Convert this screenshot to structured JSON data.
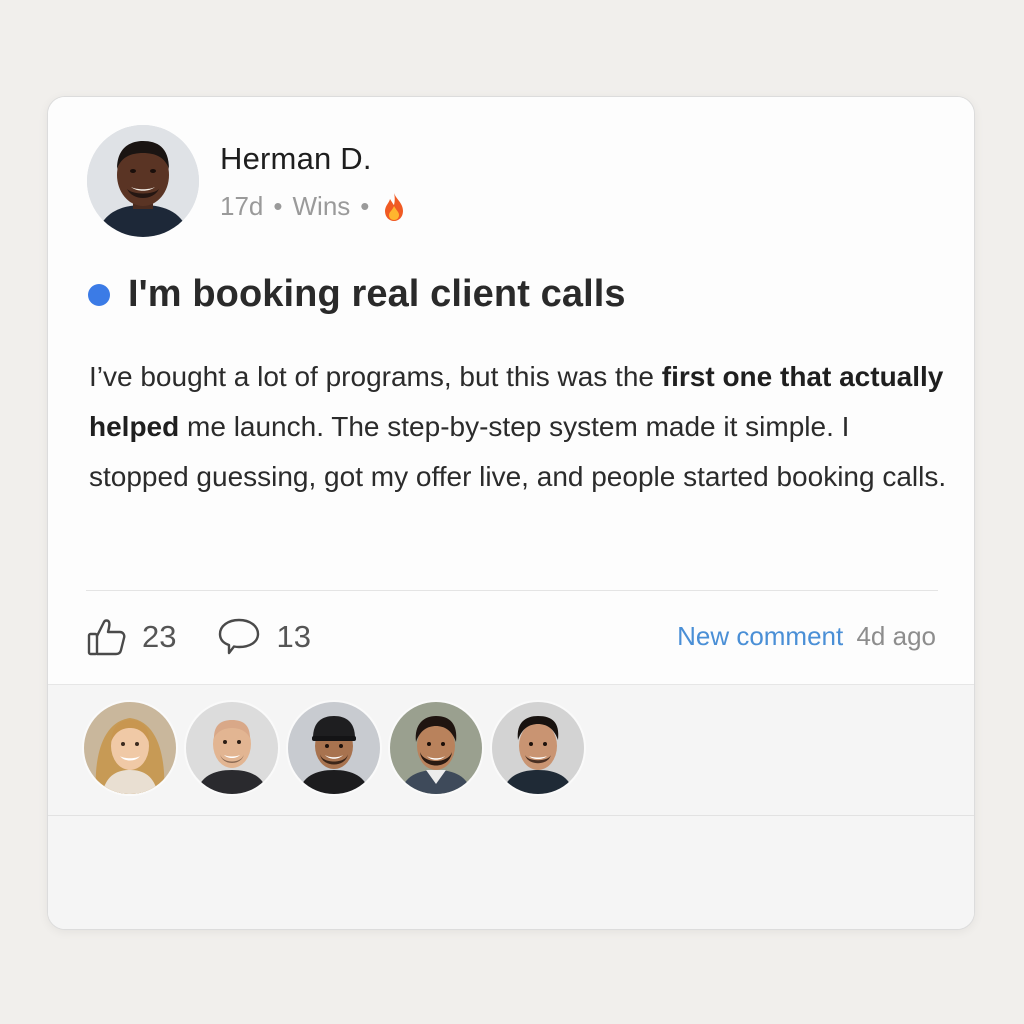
{
  "post": {
    "author": {
      "name": "Herman D.",
      "age": "17d",
      "category": "Wins",
      "separator": "•",
      "avatar_icon": "author-avatar"
    },
    "title": "I'm booking real client calls",
    "body": {
      "part1": "I’ve bought a lot of programs, but this was the ",
      "bold": "first one that actually helped",
      "part2": " me launch. The step-by-step system made it simple. I stopped guessing, got my offer live, and people started booking calls."
    },
    "likes": "23",
    "comments": "13",
    "activity_link": "New comment",
    "activity_time": "4d ago"
  },
  "participants": [
    {
      "name": "participant-1"
    },
    {
      "name": "participant-2"
    },
    {
      "name": "participant-3"
    },
    {
      "name": "participant-4"
    },
    {
      "name": "participant-5"
    }
  ],
  "colors": {
    "accent": "#3b7be6",
    "link": "#4a8fd6",
    "muted": "#9a9a9a"
  }
}
